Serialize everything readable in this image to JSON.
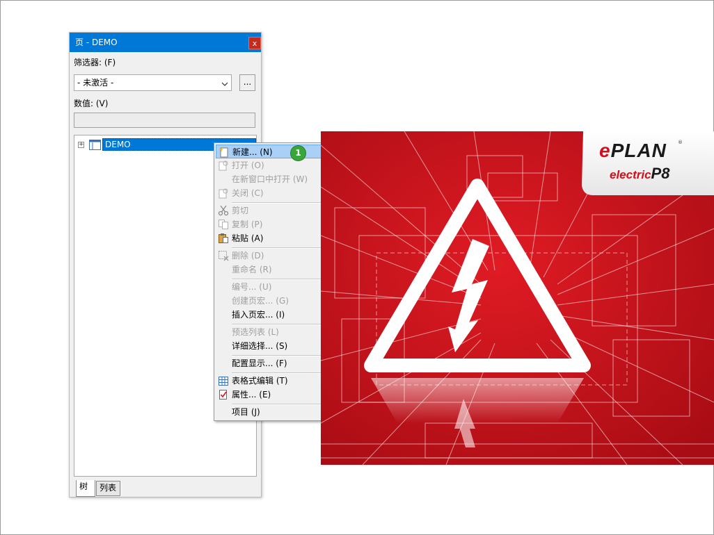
{
  "panel": {
    "title": "页 - DEMO",
    "close_label": "x",
    "filter_label": "筛选器: (F)",
    "filter_value": "- 未激活 -",
    "more_button_label": "...",
    "value_label": "数值: (V)",
    "value_input": "",
    "tree": {
      "expand_glyph": "+",
      "root_item": "DEMO"
    },
    "tabs": [
      {
        "label": "树",
        "active": true
      },
      {
        "label": "列表",
        "active": false
      }
    ]
  },
  "context_menu": {
    "items": [
      {
        "label": "新建... (N)",
        "enabled": true,
        "highlighted": true,
        "icon": "new-page-icon"
      },
      {
        "label": "打开 (O)",
        "enabled": false,
        "icon": "open-page-icon"
      },
      {
        "label": "在新窗口中打开 (W)",
        "enabled": false,
        "icon": ""
      },
      {
        "label": "关闭 (C)",
        "enabled": false,
        "icon": "close-page-icon"
      },
      {
        "label": "剪切",
        "enabled": false,
        "icon": "scissors-icon"
      },
      {
        "label": "复制 (P)",
        "enabled": false,
        "icon": "copy-icon"
      },
      {
        "label": "粘贴 (A)",
        "enabled": true,
        "icon": "paste-icon"
      },
      {
        "label": "删除 (D)",
        "enabled": false,
        "icon": "delete-icon"
      },
      {
        "label": "重命名 (R)",
        "enabled": false,
        "icon": ""
      },
      {
        "label": "编号... (U)",
        "enabled": false,
        "icon": ""
      },
      {
        "label": "创建页宏... (G)",
        "enabled": false,
        "icon": ""
      },
      {
        "label": "插入页宏... (I)",
        "enabled": true,
        "icon": ""
      },
      {
        "label": "预选列表 (L)",
        "enabled": false,
        "icon": ""
      },
      {
        "label": "详细选择... (S)",
        "enabled": true,
        "icon": ""
      },
      {
        "label": "配置显示... (F)",
        "enabled": true,
        "icon": ""
      },
      {
        "label": "表格式编辑 (T)",
        "enabled": true,
        "icon": "table-icon"
      },
      {
        "label": "属性... (E)",
        "enabled": true,
        "icon": "properties-icon"
      },
      {
        "label": "项目 (J)",
        "enabled": true,
        "icon": "",
        "submenu": true
      }
    ],
    "step_badge": "1"
  },
  "splash": {
    "logo_e": "e",
    "logo_rest": "PLAN",
    "logo_registered": "®",
    "logo_sub": "electric",
    "logo_version": "P8",
    "background_color": "#c8101c",
    "icon": "high-voltage-warning-icon"
  }
}
